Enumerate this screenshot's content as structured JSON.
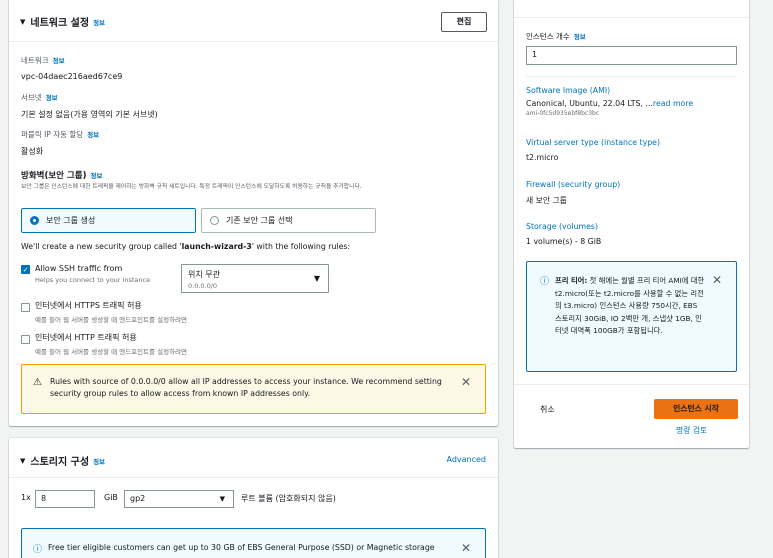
{
  "network": {
    "title": "네트워크 설정",
    "info": "정보",
    "edit": "편집",
    "network_label": "네트워크",
    "network_value": "vpc-04daec216aed67ce9",
    "subnet_label": "서브넷",
    "subnet_value": "기본 설정 없음(가용 영역의 기본 서브넷)",
    "public_ip_label": "퍼블릭 IP 자동 할당",
    "public_ip_value": "활성화",
    "firewall_title": "방화벽(보안 그룹)",
    "firewall_desc": "보안 그룹은 인스턴스에 대한 트래픽을 제어하는 방화벽 규칙 세트입니다. 특정 트래픽이 인스턴스에 도달하도록 허용하는 규칙을 추가합니다.",
    "radio_create": "보안 그룹 생성",
    "radio_existing": "기존 보안 그룹 선택",
    "rules_text_pre": "We'll create a new security group called '",
    "rules_text_name": "launch-wizard-3",
    "rules_text_post": "' with the following rules:",
    "ssh_label": "Allow SSH traffic from",
    "ssh_help": "Helps you connect to your instance",
    "ssh_source": "위치 무관",
    "ssh_cidr": "0.0.0.0/0",
    "https_label": "인터넷에서 HTTPS 트래픽 허용",
    "https_help": "예를 들어 웹 서버를 생성할 때 엔드포인트를 설정하려면",
    "http_label": "인터넷에서 HTTP 트래픽 허용",
    "http_help": "예를 들어 웹 서버를 생성할 때 엔드포인트를 설정하려면",
    "warning": "Rules with source of 0.0.0.0/0 allow all IP addresses to access your instance. We recommend setting security group rules to allow access from known IP addresses only."
  },
  "storage": {
    "title": "스토리지 구성",
    "info": "정보",
    "advanced": "Advanced",
    "count_prefix": "1x",
    "size": "8",
    "unit": "GiB",
    "type": "gp2",
    "root_volume": "루트 볼륨 (암호화되지 않음)",
    "notice": "Free tier eligible customers can get up to 30 GB of EBS General Purpose (SSD) or Magnetic storage"
  },
  "summary": {
    "instances_label": "인스턴스 개수",
    "instances_info": "정보",
    "instances_value": "1",
    "ami_label": "Software Image (AMI)",
    "ami_value": "Canonical, Ubuntu, 22.04 LTS, ...",
    "ami_more": "read more",
    "ami_id": "ami-0fc5d935ebf8bc3bc",
    "type_label": "Virtual server type (instance type)",
    "type_value": "t2.micro",
    "firewall_label": "Firewall (security group)",
    "firewall_value": "새 보안 그룹",
    "storage_label": "Storage (volumes)",
    "storage_value": "1 volume(s) - 8 GiB",
    "free_tier_title": "프리 티어:",
    "free_tier_text": " 첫 해에는 월별 프리 티어 AMI에 대한 t2.micro(또는 t2.micro를 사용할 수 없는 리전의 t3.micro) 인스턴스 사용량 750시간, EBS 스토리지 30GiB, IO 2백만 개, 스냅샷 1GB, 인터넷 대역폭 100GB가 포함됩니다.",
    "cancel": "취소",
    "launch": "인스턴스 시작",
    "review": "명령 검토"
  },
  "colors": {
    "accent": "#0073bb",
    "launch": "#ec7211",
    "warning_bg": "#fef8e7",
    "warning_border": "#ff9900",
    "selected_bg": "#f1faff"
  }
}
